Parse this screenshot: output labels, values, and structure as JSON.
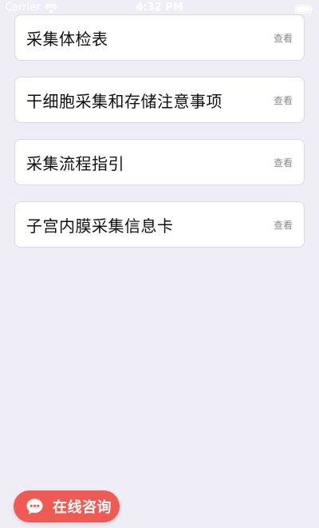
{
  "status_bar": {
    "carrier": "Carrier",
    "time": "4:32 PM",
    "icons": [
      "wifi-icon",
      "battery-icon"
    ]
  },
  "items": [
    {
      "title": "采集体检表",
      "action": "查看"
    },
    {
      "title": "干细胞采集和存储注意事项",
      "action": "查看"
    },
    {
      "title": "采集流程指引",
      "action": "查看"
    },
    {
      "title": "子宫内膜采集信息卡",
      "action": "查看"
    }
  ],
  "consult_button": {
    "label": "在线咨询",
    "icon": "chat-bubble-icon",
    "color": "#ef5a52"
  },
  "colors": {
    "page_background": "#efedf5",
    "card_background": "#ffffff",
    "card_border": "#d9d7e1",
    "action_text": "#8a8a8a"
  }
}
